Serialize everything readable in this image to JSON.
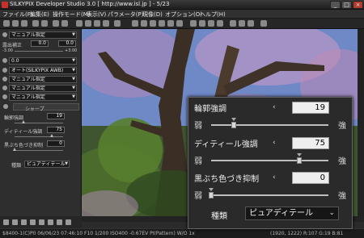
{
  "titlebar": {
    "title": "SILKYPIX Developer Studio 3.0 [ http://www.isl.jp ] - 5/23",
    "minimize": "_",
    "maximize": "□",
    "close": "×"
  },
  "menu": [
    "ファイル(F)",
    "編集(E)",
    "操作モード(M)",
    "表示(V)",
    "パラメータ(P)",
    "現像(D)",
    "オプション(O)",
    "ヘルプ(H)"
  ],
  "left_panel": {
    "rows": [
      {
        "label": "マニュアル指定"
      },
      {
        "label": "マニュアル指定"
      },
      {
        "label": "オート(SILKYPIX AWB)"
      },
      {
        "label": "マニュアル指定"
      },
      {
        "label": "マニュアル指定"
      },
      {
        "label": "マニュアル指定"
      }
    ],
    "exposure_label": "露出補正",
    "exposure_values": [
      "0.0",
      "0.0"
    ],
    "scale_min": "-3.00",
    "scale_max": "+3.00",
    "value_00": "0.0",
    "sharp_tab": "シャープ",
    "sharp": {
      "outline_label": "輪郭強調",
      "outline_value": "19",
      "detail_label": "ディティール強調",
      "detail_value": "75",
      "fringe_label": "黒ぶち色づき抑制",
      "fringe_value": "0",
      "type_label": "種類",
      "type_value": "ピュアディテール"
    }
  },
  "statusbar": {
    "left": "$8400-1(C)P0 06/06/23 07:46:10 F10 1/200 ISO400 -0.67EV  PI(Pattern) W/O  1x",
    "right": "(1920, 1222) R:107  G:19  B:81"
  },
  "popup": {
    "weak": "弱",
    "strong": "強",
    "rows": [
      {
        "label": "輪郭強調",
        "value": "19",
        "level": 0.19
      },
      {
        "label": "ディティール強調",
        "value": "75",
        "level": 0.75
      },
      {
        "label": "黒ぶち色づき抑制",
        "value": "0",
        "level": 0.0
      }
    ],
    "type_label": "種類",
    "type_value": "ピュアディテール",
    "arrows": "‹ ›"
  },
  "colors": {
    "panel_bg": "#2a2a2a",
    "sky": "#6a86c8",
    "blossom": "#c58ab8",
    "bark": "#4b3b2c",
    "leaves": "#3e5f2a"
  }
}
